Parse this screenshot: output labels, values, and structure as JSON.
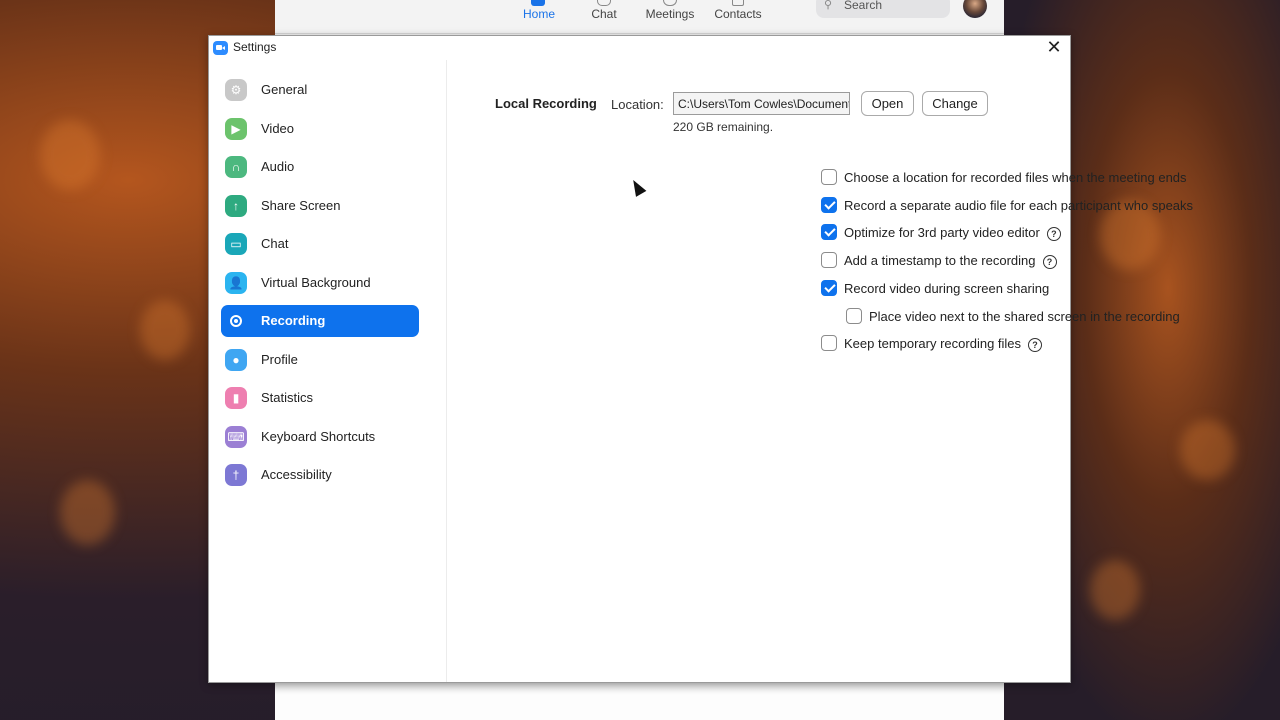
{
  "main_window": {
    "nav_tabs": [
      {
        "label": "Home",
        "icon": "home-icon",
        "active": true
      },
      {
        "label": "Chat",
        "icon": "chat-bubble-icon",
        "active": false
      },
      {
        "label": "Meetings",
        "icon": "clock-icon",
        "active": false
      },
      {
        "label": "Contacts",
        "icon": "contacts-icon",
        "active": false
      }
    ],
    "search_placeholder": "Search"
  },
  "dialog": {
    "title": "Settings",
    "close_glyph": "✕"
  },
  "sidebar": {
    "items": [
      {
        "label": "General",
        "icon": "gear-icon",
        "color": "#c8c8c8",
        "glyph": "⚙",
        "active": false
      },
      {
        "label": "Video",
        "icon": "video-camera-icon",
        "color": "#6cc36c",
        "glyph": "▶",
        "active": false
      },
      {
        "label": "Audio",
        "icon": "headphones-icon",
        "color": "#4cb87f",
        "glyph": "∩",
        "active": false
      },
      {
        "label": "Share Screen",
        "icon": "share-screen-icon",
        "color": "#2eaa80",
        "glyph": "↑",
        "active": false
      },
      {
        "label": "Chat",
        "icon": "chat-bubble-icon",
        "color": "#1aa7b8",
        "glyph": "▭",
        "active": false
      },
      {
        "label": "Virtual Background",
        "icon": "virtual-background-icon",
        "color": "#2bb4f0",
        "glyph": "👤",
        "active": false
      },
      {
        "label": "Recording",
        "icon": "record-icon",
        "color": "#0e72ed",
        "glyph": "",
        "active": true
      },
      {
        "label": "Profile",
        "icon": "profile-icon",
        "color": "#3fa6f2",
        "glyph": "●",
        "active": false
      },
      {
        "label": "Statistics",
        "icon": "statistics-icon",
        "color": "#ee7fb0",
        "glyph": "▮",
        "active": false
      },
      {
        "label": "Keyboard Shortcuts",
        "icon": "keyboard-icon",
        "color": "#9b7fd4",
        "glyph": "⌨",
        "active": false
      },
      {
        "label": "Accessibility",
        "icon": "accessibility-icon",
        "color": "#7d78d4",
        "glyph": "†",
        "active": false
      }
    ]
  },
  "recording": {
    "section_title": "Local Recording",
    "location_label": "Location:",
    "location_value": "C:\\Users\\Tom Cowles\\Documents\\Zoom",
    "open_label": "Open",
    "change_label": "Change",
    "remaining": "220 GB remaining.",
    "help_glyph": "?",
    "options": [
      {
        "label": "Choose a location for recorded files when the meeting ends",
        "checked": false,
        "help": false,
        "indent": false
      },
      {
        "label": "Record a separate audio file for each participant who speaks",
        "checked": true,
        "help": false,
        "indent": false
      },
      {
        "label": "Optimize for 3rd party video editor",
        "checked": true,
        "help": true,
        "indent": false
      },
      {
        "label": "Add a timestamp to the recording",
        "checked": false,
        "help": true,
        "indent": false
      },
      {
        "label": "Record video during screen sharing",
        "checked": true,
        "help": false,
        "indent": false
      },
      {
        "label": "Place video next to the shared screen in the recording",
        "checked": false,
        "help": false,
        "indent": true
      },
      {
        "label": "Keep temporary recording files",
        "checked": false,
        "help": true,
        "indent": false
      }
    ]
  },
  "colors": {
    "accent": "#0e72ed"
  }
}
